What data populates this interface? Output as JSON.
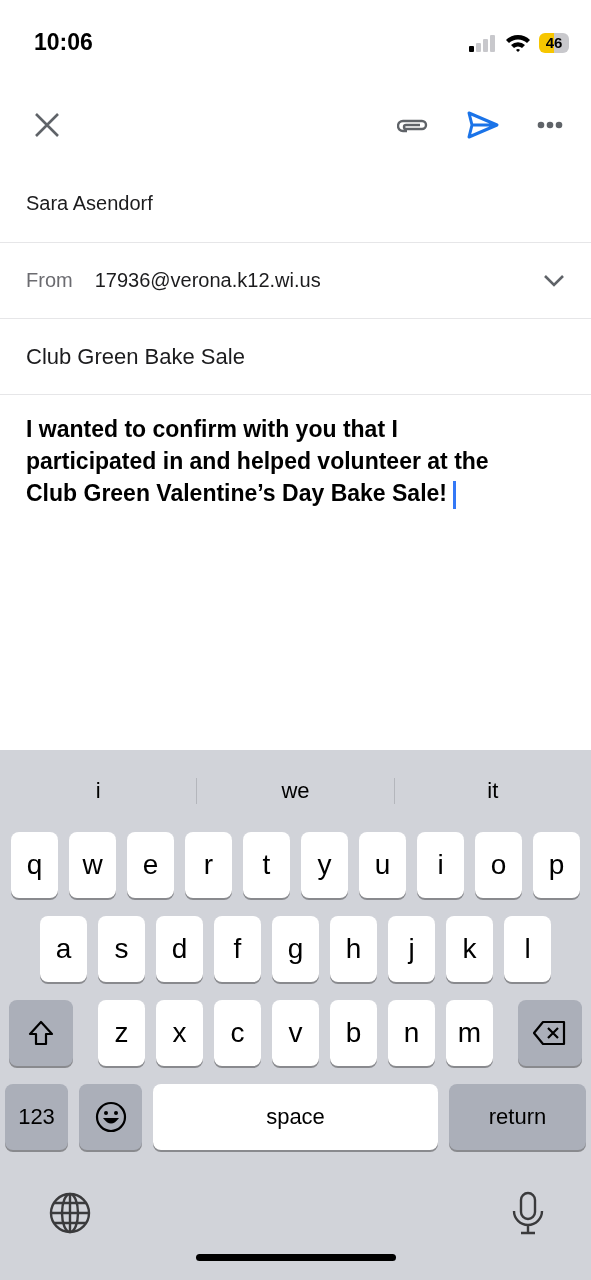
{
  "status_bar": {
    "time": "10:06",
    "battery": "46"
  },
  "toolbar": {
    "buttons": [
      {
        "kind": "close"
      },
      {
        "kind": "attach"
      },
      {
        "kind": "send"
      },
      {
        "kind": "more"
      }
    ]
  },
  "compose": {
    "to": "Sara Asendorf",
    "from_label": "From",
    "from": "17936@verona.k12.wi.us",
    "subject": "Club Green Bake Sale",
    "body": "I wanted to confirm with you that I participated in and helped volunteer at the Club Green Valentine’s Day Bake Sale!"
  },
  "keyboard": {
    "suggestions": [
      "i",
      "we",
      "it"
    ],
    "rows": [
      {
        "keys": [
          {
            "kind": "letter",
            "label": "q"
          },
          {
            "kind": "letter",
            "label": "w"
          },
          {
            "kind": "letter",
            "label": "e"
          },
          {
            "kind": "letter",
            "label": "r"
          },
          {
            "kind": "letter",
            "label": "t"
          },
          {
            "kind": "letter",
            "label": "y"
          },
          {
            "kind": "letter",
            "label": "u"
          },
          {
            "kind": "letter",
            "label": "i"
          },
          {
            "kind": "letter",
            "label": "o"
          },
          {
            "kind": "letter",
            "label": "p"
          }
        ]
      },
      {
        "keys": [
          {
            "kind": "letter",
            "label": "a"
          },
          {
            "kind": "letter",
            "label": "s"
          },
          {
            "kind": "letter",
            "label": "d"
          },
          {
            "kind": "letter",
            "label": "f"
          },
          {
            "kind": "letter",
            "label": "g"
          },
          {
            "kind": "letter",
            "label": "h"
          },
          {
            "kind": "letter",
            "label": "j"
          },
          {
            "kind": "letter",
            "label": "k"
          },
          {
            "kind": "letter",
            "label": "l"
          }
        ]
      },
      {
        "keys": [
          {
            "kind": "shift"
          },
          {
            "kind": "letter",
            "label": "z"
          },
          {
            "kind": "letter",
            "label": "x"
          },
          {
            "kind": "letter",
            "label": "c"
          },
          {
            "kind": "letter",
            "label": "v"
          },
          {
            "kind": "letter",
            "label": "b"
          },
          {
            "kind": "letter",
            "label": "n"
          },
          {
            "kind": "letter",
            "label": "m"
          },
          {
            "kind": "delete"
          }
        ]
      },
      {
        "keys": [
          {
            "kind": "numbers",
            "label": "123"
          },
          {
            "kind": "emoji"
          },
          {
            "kind": "space",
            "label": "space"
          },
          {
            "kind": "return",
            "label": "return"
          }
        ]
      }
    ]
  }
}
